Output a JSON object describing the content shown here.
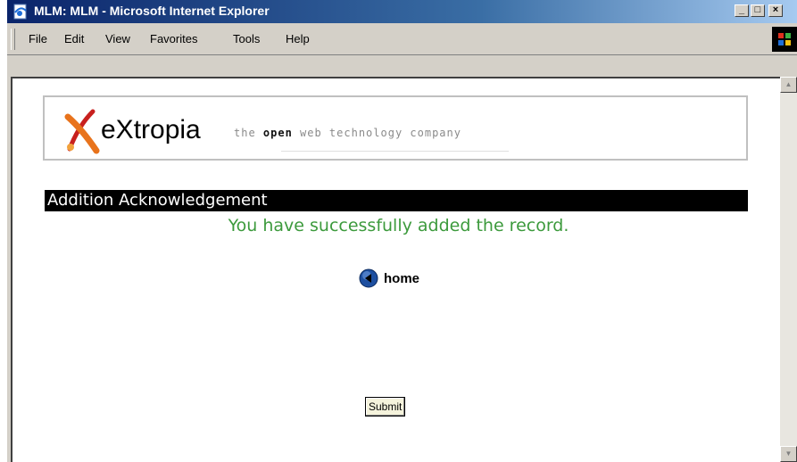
{
  "window": {
    "title": "MLM: MLM - Microsoft Internet Explorer",
    "minimize_glyph": "_",
    "maximize_glyph": "□",
    "close_glyph": "×"
  },
  "menu": {
    "items": [
      "File",
      "Edit",
      "View",
      "Favorites",
      "Tools",
      "Help"
    ]
  },
  "logo": {
    "wordmark": "eXtropia",
    "tagline_prefix": "the ",
    "tagline_bold": "open",
    "tagline_suffix": " web technology company",
    "colors": {
      "mark_primary": "#e8731c",
      "mark_secondary": "#c8201e"
    }
  },
  "page": {
    "section_title": "Addition Acknowledgement",
    "message": "You have successfully added the record.",
    "home_link": "home",
    "submit_label": "Submit",
    "colors": {
      "message": "#3c9a3c",
      "section_bar": "#000000",
      "submit_bg": "#f5f3dc"
    }
  },
  "icons": {
    "browser": "ie-page-icon",
    "home": "back-arrow-circle-icon",
    "brand": "windows-logo-icon"
  }
}
